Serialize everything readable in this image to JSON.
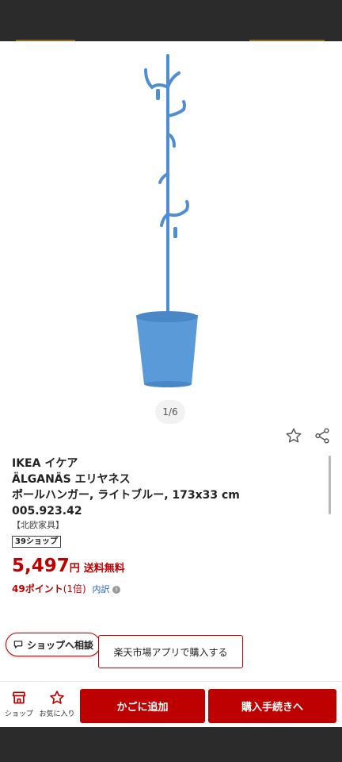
{
  "pager": {
    "text": "1/6"
  },
  "product": {
    "title_lines": [
      "IKEA イケア",
      "ÄLGANÄS エリヤネス",
      "ポールハンガー, ライトブルー, 173x33 cm",
      "005.923.42"
    ],
    "category": "【北欧家具】",
    "badge": "39ショップ",
    "price": "5,497",
    "currency": "円",
    "shipping": "送料無料",
    "points": "49ポイント",
    "points_multiplier": "(1倍)",
    "points_detail": "内訳"
  },
  "actions": {
    "consult_label": "ショップへ相談",
    "app_buy_label": "楽天市場アプリで購入する"
  },
  "bottom_nav": {
    "shop_label": "ショップ",
    "favorite_label": "お気に入り",
    "add_cart_label": "かごに追加",
    "checkout_label": "購入手続きへ"
  },
  "colors": {
    "accent": "#bf0000",
    "product_blue": "#4f8fd1"
  },
  "icons": {
    "favorite": "star-outline-icon",
    "share": "share-icon",
    "consult": "chat-icon",
    "shop": "store-icon",
    "info": "info-icon"
  }
}
